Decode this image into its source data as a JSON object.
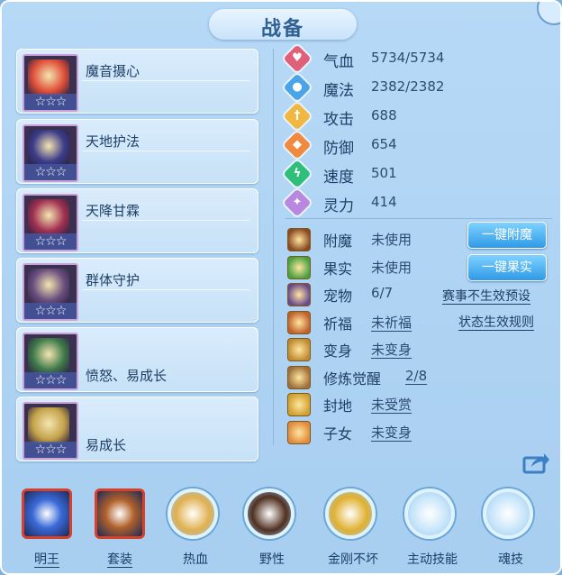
{
  "window": {
    "title": "战备"
  },
  "equipment_cards": [
    {
      "name": "魔音摄心",
      "stars": "☆☆☆",
      "color": "#e0503a"
    },
    {
      "name": "天地护法",
      "stars": "☆☆☆",
      "color": "#3c3c8a"
    },
    {
      "name": "天降甘霖",
      "stars": "☆☆☆",
      "color": "#a03050"
    },
    {
      "name": "群体守护",
      "stars": "☆☆☆",
      "color": "#6a4f7f"
    },
    {
      "name": "愤怒、易成长",
      "stars": "☆☆☆",
      "color": "#3f7a4a"
    },
    {
      "name": "易成长",
      "stars": "☆☆☆",
      "color": "#c4a24a"
    }
  ],
  "stats": [
    {
      "label": "气血",
      "value": "5734/5734",
      "color": "#e0607a",
      "icon": "heart-icon",
      "glyph": "♥"
    },
    {
      "label": "魔法",
      "value": "2382/2382",
      "color": "#4aa4e8",
      "icon": "mana-icon",
      "glyph": "●"
    },
    {
      "label": "攻击",
      "value": "688",
      "color": "#f0b840",
      "icon": "sword-icon",
      "glyph": "†"
    },
    {
      "label": "防御",
      "value": "654",
      "color": "#f08a40",
      "icon": "shield-icon",
      "glyph": "◆"
    },
    {
      "label": "速度",
      "value": "501",
      "color": "#2fbf7a",
      "icon": "lightning-icon",
      "glyph": "ϟ"
    },
    {
      "label": "灵力",
      "value": "414",
      "color": "#b888e0",
      "icon": "spirit-icon",
      "glyph": "✦"
    }
  ],
  "attributes": [
    {
      "label": "附魔",
      "value": "未使用",
      "underline": false,
      "color": "#8a4a20",
      "icon": "enchant-icon"
    },
    {
      "label": "果实",
      "value": "未使用",
      "underline": false,
      "color": "#4aa040",
      "icon": "fruit-icon"
    },
    {
      "label": "宠物",
      "value": "6/7",
      "underline": false,
      "color": "#6a4a8a",
      "icon": "pet-icon"
    },
    {
      "label": "祈福",
      "value": "未祈福",
      "underline": true,
      "color": "#c0602a",
      "icon": "blessing-icon"
    },
    {
      "label": "变身",
      "value": "未变身",
      "underline": true,
      "color": "#c08a30",
      "icon": "transform-icon"
    },
    {
      "label": "修炼觉醒",
      "value": "2/8",
      "underline": true,
      "color": "#a0703a",
      "icon": "awaken-icon"
    },
    {
      "label": "封地",
      "value": "未受赏",
      "underline": true,
      "color": "#d0a030",
      "icon": "fief-icon"
    },
    {
      "label": "子女",
      "value": "未变身",
      "underline": true,
      "color": "#e08a3a",
      "icon": "child-icon"
    }
  ],
  "buttons": {
    "enchant": "一键附魔",
    "fruit": "一键果实"
  },
  "links": {
    "event": "赛事不生效预设",
    "status": "状态生效规则"
  },
  "skills": [
    {
      "label": "明王",
      "underline": true,
      "color": "#3a6ad8"
    },
    {
      "label": "套装",
      "underline": true,
      "color": "#b0602a"
    },
    {
      "label": "热血",
      "underline": false,
      "color": "#e0b050"
    },
    {
      "label": "野性",
      "underline": false,
      "color": "#503020"
    },
    {
      "label": "金刚不坏",
      "underline": false,
      "color": "#e0b030"
    },
    {
      "label": "主动技能",
      "underline": false,
      "color": "#c8e6fa"
    },
    {
      "label": "魂技",
      "underline": false,
      "color": "#c8e6fa"
    }
  ]
}
